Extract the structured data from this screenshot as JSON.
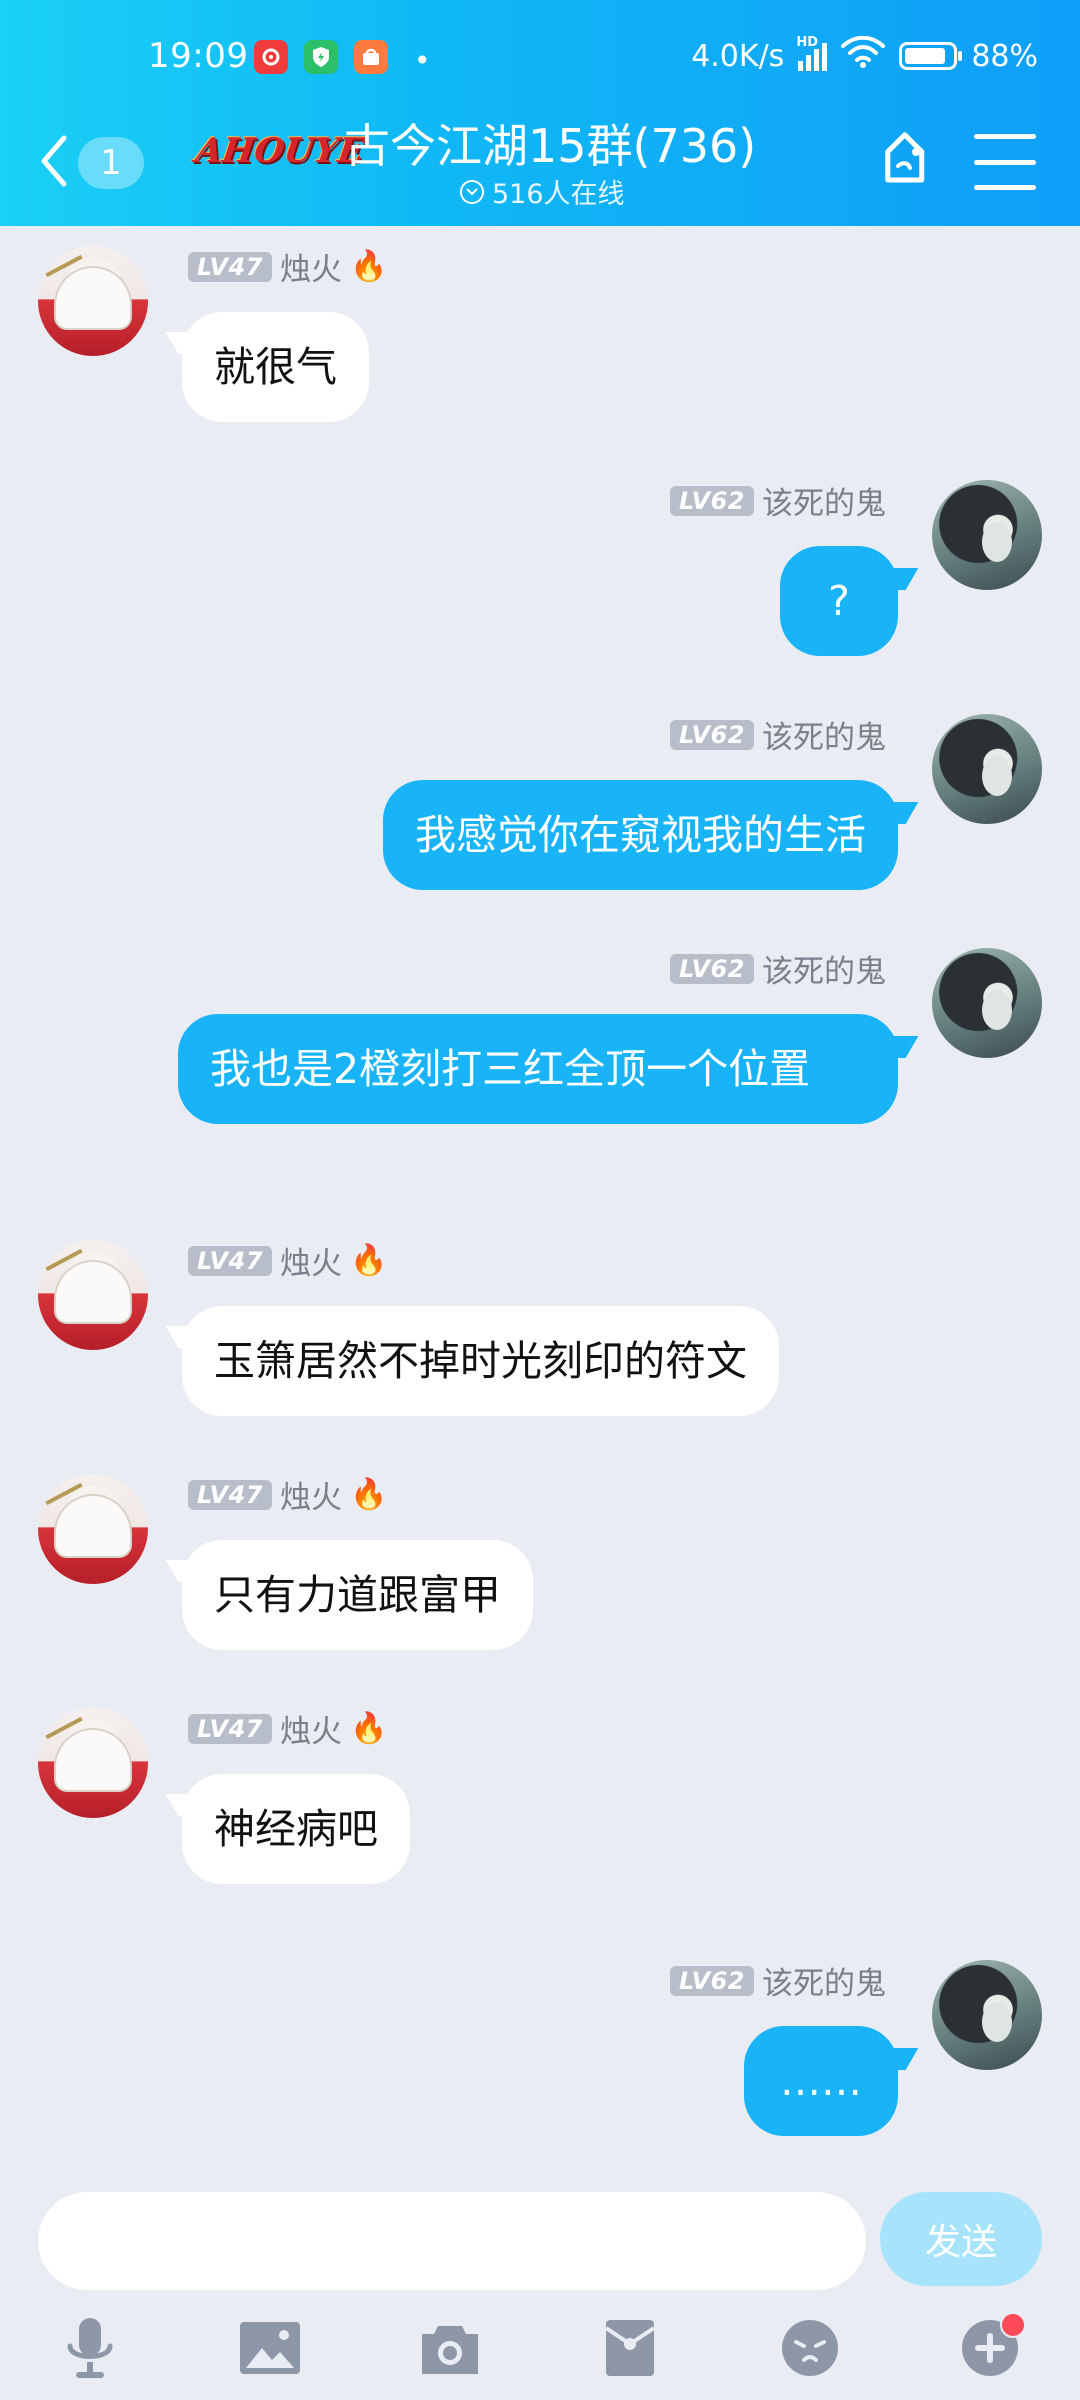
{
  "status_bar": {
    "time": "19:09",
    "speed": "4.0K/s",
    "network": "HD",
    "battery": "88%",
    "notif_icons": [
      "netease-music-icon",
      "shield-icon",
      "mi-shop-icon"
    ]
  },
  "header": {
    "unread_count": "1",
    "logo_text": "AHOUYE",
    "title": "古今江湖15群(736)",
    "online": "516人在线"
  },
  "messages": [
    {
      "side": "left",
      "level": "LV47",
      "name": "烛火",
      "text": "就很气"
    },
    {
      "side": "right",
      "level": "LV62",
      "name": "该死的鬼",
      "text": "?"
    },
    {
      "side": "right",
      "level": "LV62",
      "name": "该死的鬼",
      "text": "我感觉你在窥视我的生活"
    },
    {
      "side": "right",
      "level": "LV62",
      "name": "该死的鬼",
      "text": "我也是2橙刻打三红全顶一个位置"
    },
    {
      "side": "left",
      "level": "LV47",
      "name": "烛火",
      "text": "玉箫居然不掉时光刻印的符文"
    },
    {
      "side": "left",
      "level": "LV47",
      "name": "烛火",
      "text": "只有力道跟富甲"
    },
    {
      "side": "left",
      "level": "LV47",
      "name": "烛火",
      "text": "神经病吧"
    },
    {
      "side": "right",
      "level": "LV62",
      "name": "该死的鬼",
      "text": "……"
    }
  ],
  "input": {
    "value": "",
    "placeholder": "",
    "send_label": "发送"
  },
  "toolbar": [
    "microphone-icon",
    "image-icon",
    "camera-icon",
    "red-packet-icon",
    "emoji-icon",
    "plus-icon"
  ],
  "colors": {
    "header_start": "#1ad0f6",
    "header_end": "#0f9ef8",
    "self_bubble": "#18b4f7",
    "other_bubble": "#ffffff",
    "background": "#eaecf3",
    "send_disabled": "#a7e4fb",
    "level_badge": "#b8bdca"
  }
}
